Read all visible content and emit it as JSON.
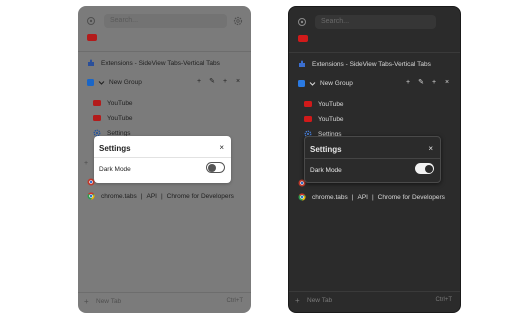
{
  "panels": [
    {
      "theme": "light",
      "search_placeholder": "Search...",
      "extension_title": "Extensions - SideView Tabs-Vertical Tabs",
      "group_name": "New Group",
      "group_actions": [
        "+",
        "✎",
        "+",
        "×"
      ],
      "tabs": [
        "YouTube",
        "YouTube",
        "Settings"
      ],
      "chrome_tab": {
        "part1": "chrome.tabs",
        "sep": "|",
        "part2": "API",
        "part3": "Chrome for Developers"
      },
      "new_tab_label": "New Tab",
      "new_tab_shortcut": "Ctrl+T",
      "dialog": {
        "title": "Settings",
        "close": "×",
        "setting_label": "Dark Mode",
        "dark_mode_on": false
      }
    },
    {
      "theme": "dark",
      "search_placeholder": "Search...",
      "extension_title": "Extensions - SideView Tabs-Vertical Tabs",
      "group_name": "New Group",
      "group_actions": [
        "+",
        "✎",
        "+",
        "×"
      ],
      "tabs": [
        "YouTube",
        "YouTube",
        "Settings"
      ],
      "chrome_tab": {
        "part1": "chrome.tabs",
        "sep": "|",
        "part2": "API",
        "part3": "Chrome for Developers"
      },
      "new_tab_label": "New Tab",
      "new_tab_shortcut": "Ctrl+T",
      "dialog": {
        "title": "Settings",
        "close": "×",
        "setting_label": "Dark Mode",
        "dark_mode_on": true
      }
    }
  ],
  "colors": {
    "light_bg": "#7b7b7b",
    "dark_bg": "#2b2b2b",
    "group_blue": "#1a66c7",
    "youtube_red": "#d11a1a"
  }
}
